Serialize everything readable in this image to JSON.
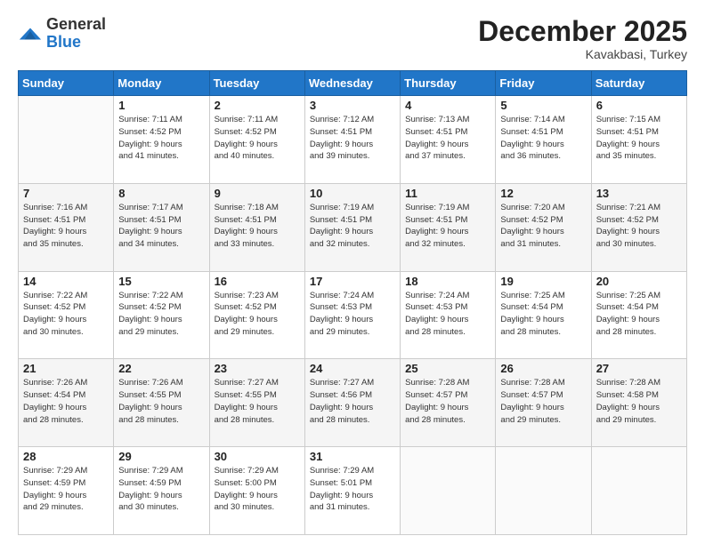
{
  "header": {
    "logo_line1": "General",
    "logo_line2": "Blue",
    "month_year": "December 2025",
    "location": "Kavakbasi, Turkey"
  },
  "calendar": {
    "days_of_week": [
      "Sunday",
      "Monday",
      "Tuesday",
      "Wednesday",
      "Thursday",
      "Friday",
      "Saturday"
    ],
    "weeks": [
      [
        {
          "day": "",
          "info": ""
        },
        {
          "day": "1",
          "info": "Sunrise: 7:11 AM\nSunset: 4:52 PM\nDaylight: 9 hours\nand 41 minutes."
        },
        {
          "day": "2",
          "info": "Sunrise: 7:11 AM\nSunset: 4:52 PM\nDaylight: 9 hours\nand 40 minutes."
        },
        {
          "day": "3",
          "info": "Sunrise: 7:12 AM\nSunset: 4:51 PM\nDaylight: 9 hours\nand 39 minutes."
        },
        {
          "day": "4",
          "info": "Sunrise: 7:13 AM\nSunset: 4:51 PM\nDaylight: 9 hours\nand 37 minutes."
        },
        {
          "day": "5",
          "info": "Sunrise: 7:14 AM\nSunset: 4:51 PM\nDaylight: 9 hours\nand 36 minutes."
        },
        {
          "day": "6",
          "info": "Sunrise: 7:15 AM\nSunset: 4:51 PM\nDaylight: 9 hours\nand 35 minutes."
        }
      ],
      [
        {
          "day": "7",
          "info": "Sunrise: 7:16 AM\nSunset: 4:51 PM\nDaylight: 9 hours\nand 35 minutes."
        },
        {
          "day": "8",
          "info": "Sunrise: 7:17 AM\nSunset: 4:51 PM\nDaylight: 9 hours\nand 34 minutes."
        },
        {
          "day": "9",
          "info": "Sunrise: 7:18 AM\nSunset: 4:51 PM\nDaylight: 9 hours\nand 33 minutes."
        },
        {
          "day": "10",
          "info": "Sunrise: 7:19 AM\nSunset: 4:51 PM\nDaylight: 9 hours\nand 32 minutes."
        },
        {
          "day": "11",
          "info": "Sunrise: 7:19 AM\nSunset: 4:51 PM\nDaylight: 9 hours\nand 32 minutes."
        },
        {
          "day": "12",
          "info": "Sunrise: 7:20 AM\nSunset: 4:52 PM\nDaylight: 9 hours\nand 31 minutes."
        },
        {
          "day": "13",
          "info": "Sunrise: 7:21 AM\nSunset: 4:52 PM\nDaylight: 9 hours\nand 30 minutes."
        }
      ],
      [
        {
          "day": "14",
          "info": "Sunrise: 7:22 AM\nSunset: 4:52 PM\nDaylight: 9 hours\nand 30 minutes."
        },
        {
          "day": "15",
          "info": "Sunrise: 7:22 AM\nSunset: 4:52 PM\nDaylight: 9 hours\nand 29 minutes."
        },
        {
          "day": "16",
          "info": "Sunrise: 7:23 AM\nSunset: 4:52 PM\nDaylight: 9 hours\nand 29 minutes."
        },
        {
          "day": "17",
          "info": "Sunrise: 7:24 AM\nSunset: 4:53 PM\nDaylight: 9 hours\nand 29 minutes."
        },
        {
          "day": "18",
          "info": "Sunrise: 7:24 AM\nSunset: 4:53 PM\nDaylight: 9 hours\nand 28 minutes."
        },
        {
          "day": "19",
          "info": "Sunrise: 7:25 AM\nSunset: 4:54 PM\nDaylight: 9 hours\nand 28 minutes."
        },
        {
          "day": "20",
          "info": "Sunrise: 7:25 AM\nSunset: 4:54 PM\nDaylight: 9 hours\nand 28 minutes."
        }
      ],
      [
        {
          "day": "21",
          "info": "Sunrise: 7:26 AM\nSunset: 4:54 PM\nDaylight: 9 hours\nand 28 minutes."
        },
        {
          "day": "22",
          "info": "Sunrise: 7:26 AM\nSunset: 4:55 PM\nDaylight: 9 hours\nand 28 minutes."
        },
        {
          "day": "23",
          "info": "Sunrise: 7:27 AM\nSunset: 4:55 PM\nDaylight: 9 hours\nand 28 minutes."
        },
        {
          "day": "24",
          "info": "Sunrise: 7:27 AM\nSunset: 4:56 PM\nDaylight: 9 hours\nand 28 minutes."
        },
        {
          "day": "25",
          "info": "Sunrise: 7:28 AM\nSunset: 4:57 PM\nDaylight: 9 hours\nand 28 minutes."
        },
        {
          "day": "26",
          "info": "Sunrise: 7:28 AM\nSunset: 4:57 PM\nDaylight: 9 hours\nand 29 minutes."
        },
        {
          "day": "27",
          "info": "Sunrise: 7:28 AM\nSunset: 4:58 PM\nDaylight: 9 hours\nand 29 minutes."
        }
      ],
      [
        {
          "day": "28",
          "info": "Sunrise: 7:29 AM\nSunset: 4:59 PM\nDaylight: 9 hours\nand 29 minutes."
        },
        {
          "day": "29",
          "info": "Sunrise: 7:29 AM\nSunset: 4:59 PM\nDaylight: 9 hours\nand 30 minutes."
        },
        {
          "day": "30",
          "info": "Sunrise: 7:29 AM\nSunset: 5:00 PM\nDaylight: 9 hours\nand 30 minutes."
        },
        {
          "day": "31",
          "info": "Sunrise: 7:29 AM\nSunset: 5:01 PM\nDaylight: 9 hours\nand 31 minutes."
        },
        {
          "day": "",
          "info": ""
        },
        {
          "day": "",
          "info": ""
        },
        {
          "day": "",
          "info": ""
        }
      ]
    ]
  }
}
